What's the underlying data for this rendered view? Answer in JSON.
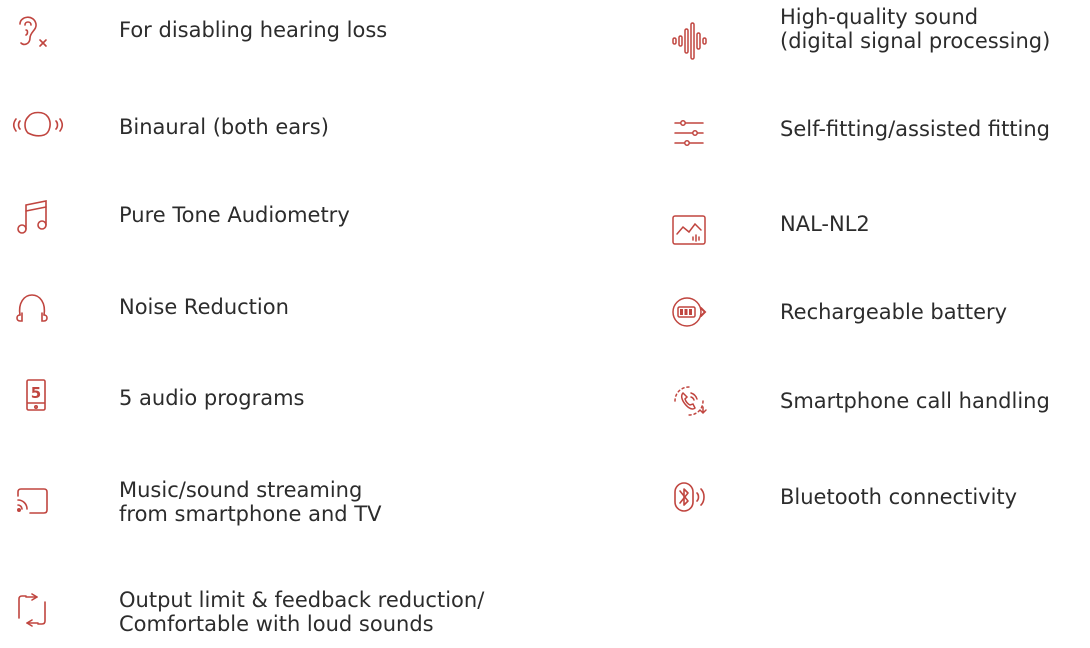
{
  "theme": {
    "icon_color": "#c0453f",
    "text_color": "#2c2c2c"
  },
  "left_features": [
    {
      "icon": "ear-muted-icon",
      "label": "For disabling hearing loss"
    },
    {
      "icon": "binaural-head-icon",
      "label": "Binaural (both ears)"
    },
    {
      "icon": "music-note-icon",
      "label": "Pure Tone Audiometry"
    },
    {
      "icon": "headphones-icon",
      "label": "Noise Reduction"
    },
    {
      "icon": "phone-five-icon",
      "icon_text": "5",
      "label": "5 audio programs"
    },
    {
      "icon": "cast-stream-icon",
      "label": "Music/sound streaming\nfrom smartphone and TV"
    },
    {
      "icon": "repeat-arrows-icon",
      "label": "Output limit & feedback reduction/\nComfortable with loud sounds"
    }
  ],
  "right_features": [
    {
      "icon": "sound-wave-icon",
      "label": "High-quality sound\n(digital signal processing)"
    },
    {
      "icon": "sliders-icon",
      "label": "Self-fitting/assisted fitting"
    },
    {
      "icon": "audiogram-chart-icon",
      "label": "NAL-NL2"
    },
    {
      "icon": "battery-charge-icon",
      "label": "Rechargeable battery"
    },
    {
      "icon": "phone-call-icon",
      "label": "Smartphone call handling"
    },
    {
      "icon": "bluetooth-icon",
      "label": "Bluetooth connectivity"
    }
  ]
}
